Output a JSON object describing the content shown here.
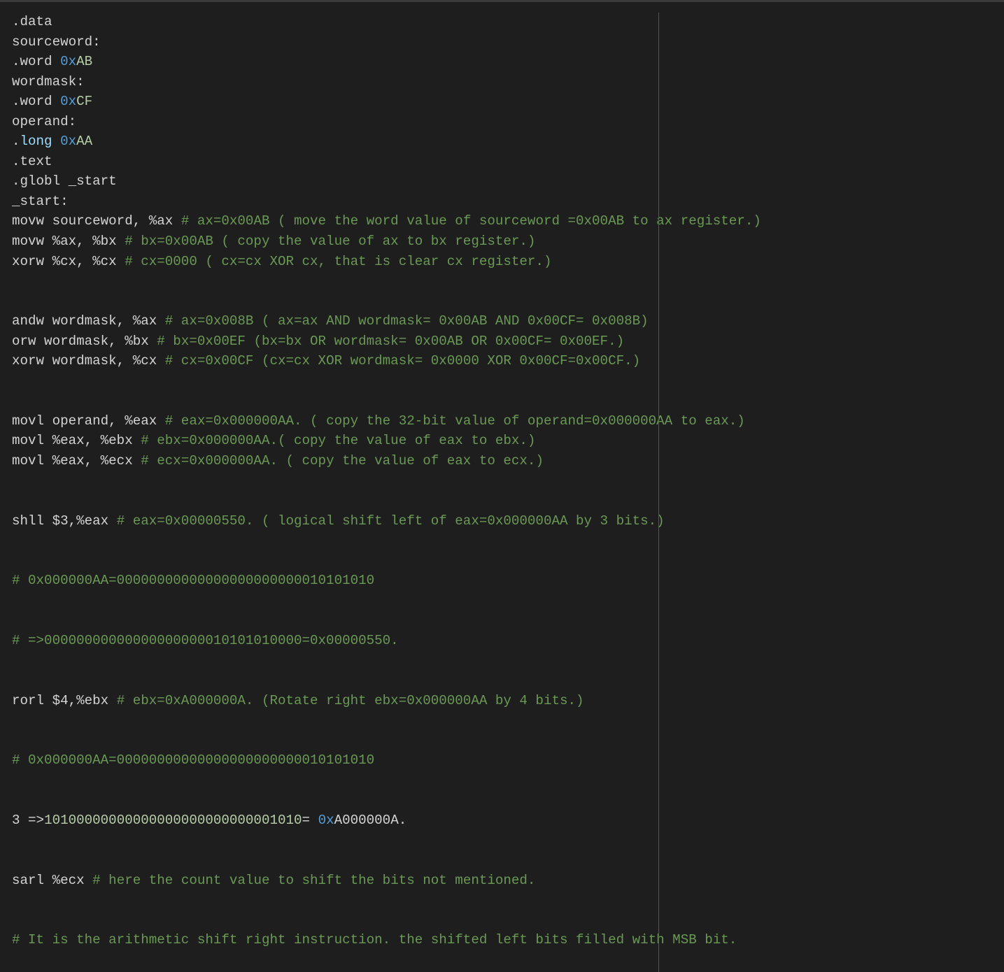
{
  "editor": {
    "lines": [
      [
        {
          "t": "plain",
          "s": ".data"
        }
      ],
      [
        {
          "t": "plain",
          "s": "sourceword:"
        }
      ],
      [
        {
          "t": "plain",
          "s": ".word "
        },
        {
          "t": "prefix",
          "s": "0x"
        },
        {
          "t": "num",
          "s": "AB"
        }
      ],
      [
        {
          "t": "plain",
          "s": "wordmask:"
        }
      ],
      [
        {
          "t": "plain",
          "s": ".word "
        },
        {
          "t": "prefix",
          "s": "0x"
        },
        {
          "t": "num",
          "s": "CF"
        }
      ],
      [
        {
          "t": "plain",
          "s": "operand:"
        }
      ],
      [
        {
          "t": "plain",
          "s": "."
        },
        {
          "t": "kw",
          "s": "long"
        },
        {
          "t": "plain",
          "s": " "
        },
        {
          "t": "prefix",
          "s": "0x"
        },
        {
          "t": "num",
          "s": "AA"
        }
      ],
      [
        {
          "t": "plain",
          "s": ".text"
        }
      ],
      [
        {
          "t": "plain",
          "s": ".globl _start"
        }
      ],
      [
        {
          "t": "plain",
          "s": "_start:"
        }
      ],
      [
        {
          "t": "plain",
          "s": "movw sourceword, %ax "
        },
        {
          "t": "comment",
          "s": "# ax=0x00AB ( move the word value of sourceword =0x00AB to ax register.)"
        }
      ],
      [
        {
          "t": "plain",
          "s": "movw %ax, %bx "
        },
        {
          "t": "comment",
          "s": "# bx=0x00AB ( copy the value of ax to bx register.)"
        }
      ],
      [
        {
          "t": "plain",
          "s": "xorw %cx, %cx "
        },
        {
          "t": "comment",
          "s": "# cx=0000 ( cx=cx XOR cx, that is clear cx register.)"
        }
      ],
      [],
      [],
      [
        {
          "t": "plain",
          "s": "andw wordmask, %ax "
        },
        {
          "t": "comment",
          "s": "# ax=0x008B ( ax=ax AND wordmask= 0x00AB AND 0x00CF= 0x008B)"
        }
      ],
      [
        {
          "t": "plain",
          "s": "orw wordmask, %bx "
        },
        {
          "t": "comment",
          "s": "# bx=0x00EF (bx=bx OR wordmask= 0x00AB OR 0x00CF= 0x00EF.)"
        }
      ],
      [
        {
          "t": "plain",
          "s": "xorw wordmask, %cx "
        },
        {
          "t": "comment",
          "s": "# cx=0x00CF (cx=cx XOR wordmask= 0x0000 XOR 0x00CF=0x00CF.)"
        }
      ],
      [],
      [],
      [
        {
          "t": "plain",
          "s": "movl operand, %eax "
        },
        {
          "t": "comment",
          "s": "# eax=0x000000AA. ( copy the 32-bit value of operand=0x000000AA to eax.)"
        }
      ],
      [
        {
          "t": "plain",
          "s": "movl %eax, %ebx "
        },
        {
          "t": "comment",
          "s": "# ebx=0x000000AA.( copy the value of eax to ebx.)"
        }
      ],
      [
        {
          "t": "plain",
          "s": "movl %eax, %ecx "
        },
        {
          "t": "comment",
          "s": "# ecx=0x000000AA. ( copy the value of eax to ecx.)"
        }
      ],
      [],
      [],
      [
        {
          "t": "plain",
          "s": "shll $3,%eax "
        },
        {
          "t": "comment",
          "s": "# eax=0x00000550. ( logical shift left of eax=0x000000AA by 3 bits.)"
        }
      ],
      [],
      [],
      [
        {
          "t": "comment",
          "s": "# 0x000000AA=00000000000000000000000010101010"
        }
      ],
      [],
      [],
      [
        {
          "t": "comment",
          "s": "# =>00000000000000000000010101010000=0x00000550."
        }
      ],
      [],
      [],
      [
        {
          "t": "plain",
          "s": "rorl $4,%ebx "
        },
        {
          "t": "comment",
          "s": "# ebx=0xA000000A. (Rotate right ebx=0x000000AA by 4 bits.)"
        }
      ],
      [],
      [],
      [
        {
          "t": "comment",
          "s": "# 0x000000AA=00000000000000000000000010101010"
        }
      ],
      [],
      [],
      [
        {
          "t": "plain",
          "s": "3 =>"
        },
        {
          "t": "num",
          "s": "10100000000000000000000000001010"
        },
        {
          "t": "plain",
          "s": "= "
        },
        {
          "t": "prefix",
          "s": "0x"
        },
        {
          "t": "plain",
          "s": "A000000A."
        }
      ],
      [],
      [],
      [
        {
          "t": "plain",
          "s": "sarl %ecx "
        },
        {
          "t": "comment",
          "s": "# here the count value to shift the bits not mentioned."
        }
      ],
      [],
      [],
      [
        {
          "t": "comment",
          "s": "# It is the arithmetic shift right instruction. the shifted left bits filled with MSB bit."
        }
      ]
    ]
  }
}
